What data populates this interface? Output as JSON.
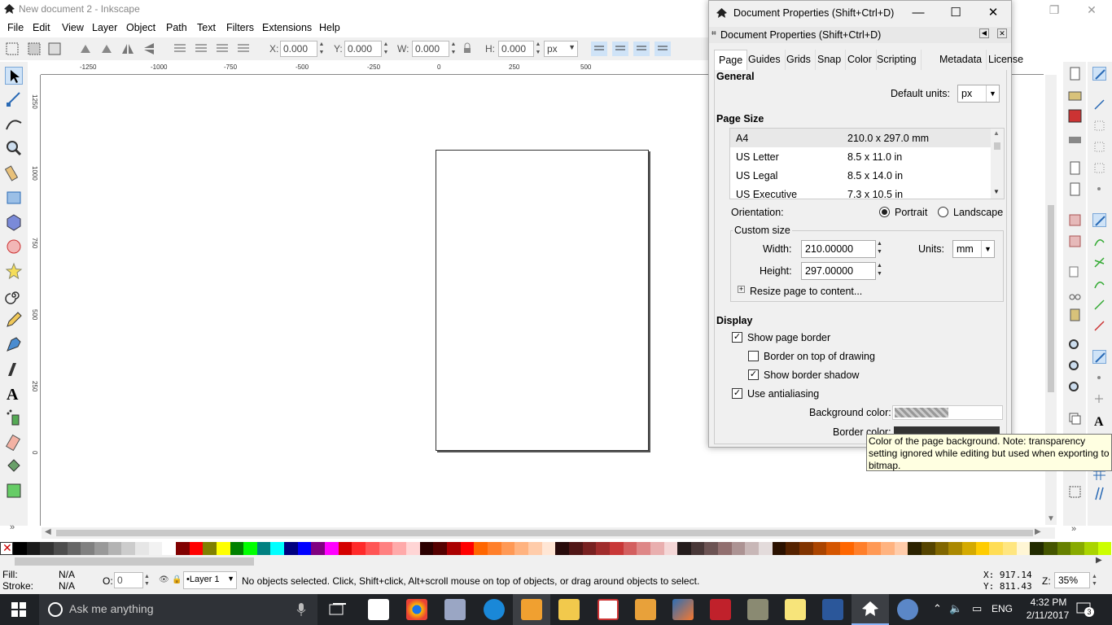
{
  "window": {
    "title": "New document 2 - Inkscape"
  },
  "menu": [
    "File",
    "Edit",
    "View",
    "Layer",
    "Object",
    "Path",
    "Text",
    "Filters",
    "Extensions",
    "Help"
  ],
  "toolbar": {
    "x_label": "X:",
    "x_value": "0.000",
    "y_label": "Y:",
    "y_value": "0.000",
    "w_label": "W:",
    "w_value": "0.000",
    "h_label": "H:",
    "h_value": "0.000",
    "unit": "px"
  },
  "ruler": {
    "h_labels": [
      "-1250",
      "-1000",
      "-750",
      "-500",
      "-250",
      "0",
      "250",
      "500"
    ],
    "v_labels": [
      "1250",
      "1000",
      "750",
      "500",
      "250",
      "0"
    ]
  },
  "dialog": {
    "title": "Document Properties (Shift+Ctrl+D)",
    "header": "Document Properties (Shift+Ctrl+D)",
    "tabs": [
      "Page",
      "Guides",
      "Grids",
      "Snap",
      "Color",
      "Scripting",
      "Metadata",
      "License"
    ],
    "general": {
      "heading": "General",
      "default_units_label": "Default units:",
      "default_units_value": "px"
    },
    "page_size": {
      "heading": "Page Size",
      "rows": [
        {
          "name": "A4",
          "size": "210.0 x 297.0 mm"
        },
        {
          "name": "US Letter",
          "size": "8.5 x 11.0 in"
        },
        {
          "name": "US Legal",
          "size": "8.5 x 14.0 in"
        },
        {
          "name": "US Executive",
          "size": "7.3 x 10.5 in"
        }
      ],
      "orientation_label": "Orientation:",
      "portrait": "Portrait",
      "landscape": "Landscape",
      "custom_size": "Custom size",
      "width_label": "Width:",
      "width_value": "210.00000",
      "height_label": "Height:",
      "height_value": "297.00000",
      "units_label": "Units:",
      "units_value": "mm",
      "resize": "Resize page to content..."
    },
    "display": {
      "heading": "Display",
      "show_border": "Show page border",
      "border_on_top": "Border on top of drawing",
      "show_shadow": "Show border shadow",
      "antialiasing": "Use antialiasing",
      "background_color": "Background color:",
      "border_color": "Border color:"
    },
    "tooltip": "Color of the page background. Note: transparency setting ignored while editing but used when exporting to bitmap."
  },
  "palette": [
    "#000000",
    "#1a1a1a",
    "#333333",
    "#4d4d4d",
    "#666666",
    "#808080",
    "#999999",
    "#b3b3b3",
    "#cccccc",
    "#e6e6e6",
    "#f2f2f2",
    "#ffffff",
    "#800000",
    "#ff0000",
    "#808000",
    "#ffff00",
    "#008000",
    "#00ff00",
    "#008080",
    "#00ffff",
    "#000080",
    "#0000ff",
    "#800080",
    "#ff00ff",
    "#d40000",
    "#ff2a2a",
    "#ff5555",
    "#ff8080",
    "#ffaaaa",
    "#ffd5d5",
    "#2b0000",
    "#550000",
    "#aa0000",
    "#ff0000",
    "#ff6600",
    "#ff7f2a",
    "#ff9955",
    "#ffb380",
    "#ffccaa",
    "#ffe6d5",
    "#280b0b",
    "#501616",
    "#782121",
    "#a02c2c",
    "#c83737",
    "#d35f5f",
    "#de8787",
    "#e9afaf",
    "#f4d7d7",
    "#241c1c",
    "#483737",
    "#6c5353",
    "#916f6f",
    "#ac9393",
    "#c8b7b7",
    "#e3dbdb",
    "#2b1100",
    "#552200",
    "#803300",
    "#aa4400",
    "#d45500",
    "#ff6600",
    "#ff7f2a",
    "#ff9955",
    "#ffb380",
    "#ffccaa",
    "#2b2200",
    "#554400",
    "#806600",
    "#aa8800",
    "#d4aa00",
    "#ffcc00",
    "#ffdd55",
    "#ffe680",
    "#fff6d5",
    "#222b00",
    "#445500",
    "#668000",
    "#88aa00",
    "#aad400",
    "#ccff00"
  ],
  "status": {
    "fill_label": "Fill:",
    "fill_value": "N/A",
    "stroke_label": "Stroke:",
    "stroke_value": "N/A",
    "opacity_label": "O:",
    "opacity_value": "0",
    "layer": "Layer 1",
    "message": "No objects selected. Click, Shift+click, Alt+scroll mouse on top of objects, or drag around objects to select.",
    "x_coord": "X: 917.14",
    "y_coord": "Y: 811.43",
    "zoom_label": "Z:",
    "zoom_value": "35%"
  },
  "taskbar": {
    "search_placeholder": "Ask me anything",
    "time": "4:32 PM",
    "date": "2/11/2017",
    "lang": "ENG",
    "notifications": "3"
  }
}
